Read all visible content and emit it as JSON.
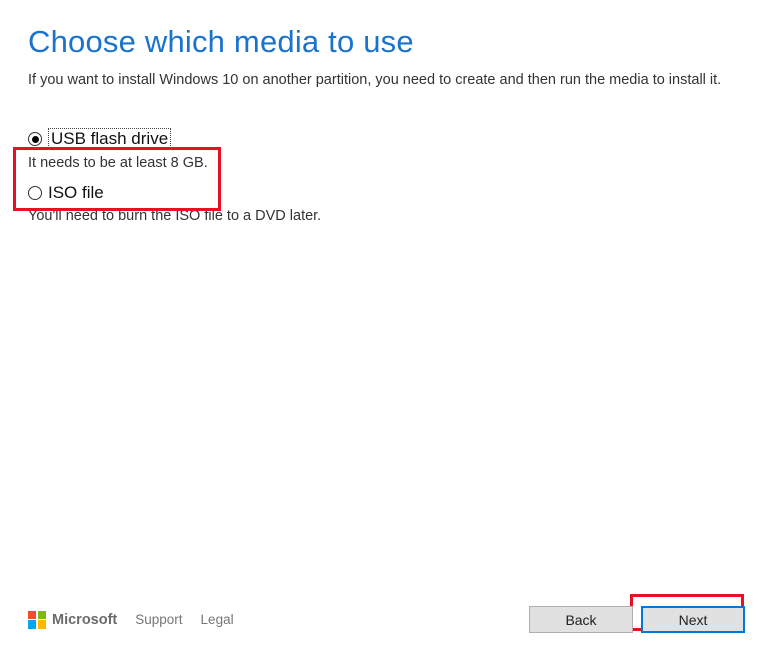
{
  "title": "Choose which media to use",
  "subtitle": "If you want to install Windows 10 on another partition, you need to create and then run the media to install it.",
  "options": [
    {
      "label": "USB flash drive",
      "description": "It needs to be at least 8 GB.",
      "selected": true
    },
    {
      "label": "ISO file",
      "description": "You'll need to burn the ISO file to a DVD later.",
      "selected": false
    }
  ],
  "footer": {
    "brand": "Microsoft",
    "links": [
      "Support",
      "Legal"
    ]
  },
  "buttons": {
    "back": "Back",
    "next": "Next"
  }
}
